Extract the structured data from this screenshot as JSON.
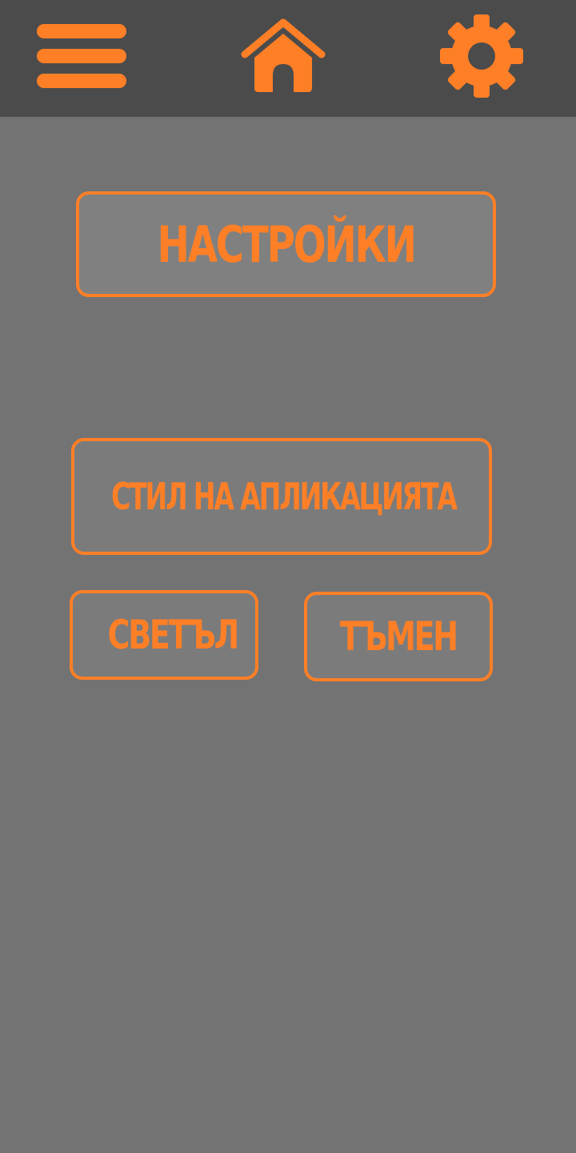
{
  "toolbar": {
    "menu_icon": "hamburger-menu-icon",
    "home_icon": "home-icon",
    "settings_icon": "gear-icon"
  },
  "header": {
    "title": "НАСТРОЙКИ"
  },
  "app_style": {
    "label": "СТИЛ НА АПЛИКАЦИЯТА",
    "options": [
      {
        "label": "СВЕТЪЛ"
      },
      {
        "label": "ТЪМЕН"
      }
    ]
  },
  "colors": {
    "accent": "#ff7f27",
    "topbar": "#4b4b4b",
    "background": "#737373"
  }
}
